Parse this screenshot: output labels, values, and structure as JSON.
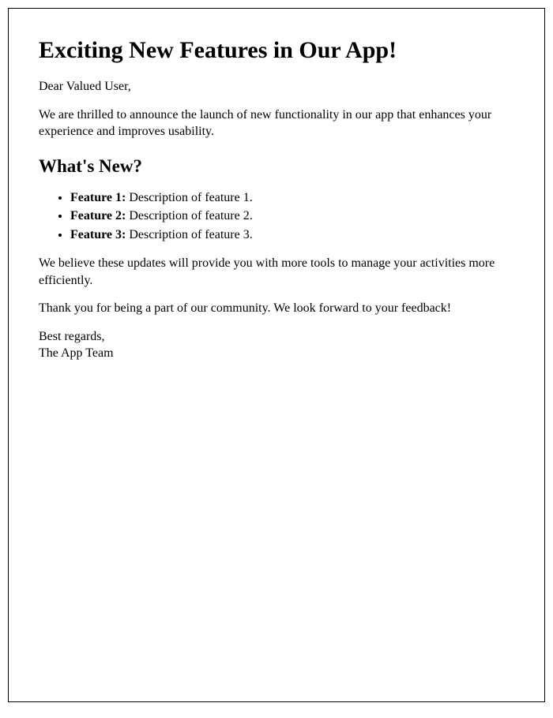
{
  "title": "Exciting New Features in Our App!",
  "greeting": "Dear Valued User,",
  "intro": "We are thrilled to announce the launch of new functionality in our app that enhances your experience and improves usability.",
  "section_heading": "What's New?",
  "features": [
    {
      "label": "Feature 1:",
      "desc": " Description of feature 1."
    },
    {
      "label": "Feature 2:",
      "desc": " Description of feature 2."
    },
    {
      "label": "Feature 3:",
      "desc": " Description of feature 3."
    }
  ],
  "belief": "We believe these updates will provide you with more tools to manage your activities more efficiently.",
  "thanks": "Thank you for being a part of our community. We look forward to your feedback!",
  "signoff_label": "Best regards,",
  "signoff_name": "The App Team"
}
